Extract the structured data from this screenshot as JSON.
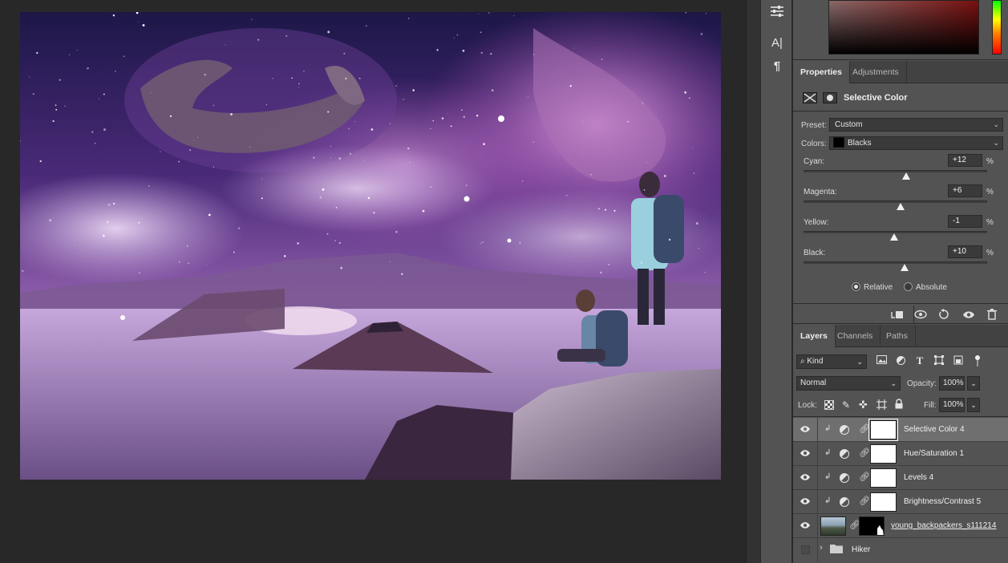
{
  "colors": {
    "panel_bg": "#535353",
    "tab_bg": "#424242",
    "workspace_bg": "#282828",
    "selected_row": "#6f6f6f"
  },
  "toolstrip": {
    "items": [
      "sliders-icon",
      "character-icon",
      "paragraph-icon"
    ],
    "character_glyph": "A|",
    "paragraph_glyph": "¶"
  },
  "properties": {
    "tabs": [
      "Properties",
      "Adjustments"
    ],
    "active_tab": "Properties",
    "title": "Selective Color",
    "preset_label": "Preset:",
    "preset_value": "Custom",
    "colors_label": "Colors:",
    "colors_value": "Blacks",
    "colors_swatch": "#000000",
    "sliders": [
      {
        "label": "Cyan:",
        "value": "+12",
        "unit": "%",
        "percent": 12
      },
      {
        "label": "Magenta:",
        "value": "+6",
        "unit": "%",
        "percent": 6
      },
      {
        "label": "Yellow:",
        "value": "-1",
        "unit": "%",
        "percent": -1
      },
      {
        "label": "Black:",
        "value": "+10",
        "unit": "%",
        "percent": 10
      }
    ],
    "method": {
      "relative_label": "Relative",
      "absolute_label": "Absolute",
      "selected": "Relative"
    },
    "footer_icons": [
      "clip-to-layer-icon",
      "view-previous-state-icon",
      "reset-icon",
      "visibility-icon",
      "trash-icon"
    ]
  },
  "layers": {
    "tabs": [
      "Layers",
      "Channels",
      "Paths"
    ],
    "active_tab": "Layers",
    "filter_kind": "Kind",
    "filter_icons": [
      "pixel-filter-icon",
      "adjustment-filter-icon",
      "type-filter-icon",
      "shape-filter-icon",
      "smart-object-filter-icon"
    ],
    "blend_mode": "Normal",
    "opacity_label": "Opacity:",
    "opacity_value": "100%",
    "lock_label": "Lock:",
    "fill_label": "Fill:",
    "fill_value": "100%",
    "rows": [
      {
        "name": "Selective Color 4",
        "type": "adjustment",
        "selected": true
      },
      {
        "name": "Hue/Saturation 1",
        "type": "adjustment",
        "selected": false
      },
      {
        "name": "Levels 4",
        "type": "adjustment",
        "selected": false
      },
      {
        "name": "Brightness/Contrast 5",
        "type": "adjustment",
        "selected": false
      },
      {
        "name": "young_backpackers_s111214",
        "type": "image",
        "selected": false
      },
      {
        "name": "Hiker",
        "type": "group",
        "selected": false
      }
    ]
  }
}
